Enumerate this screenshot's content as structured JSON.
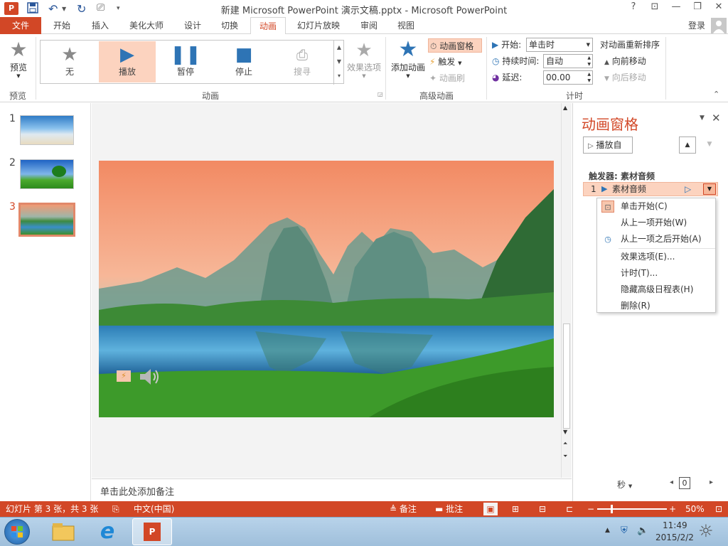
{
  "window": {
    "title": "新建 Microsoft PowerPoint 演示文稿.pptx - Microsoft PowerPoint",
    "help": "?",
    "controls": [
      "⊡",
      "—",
      "❐",
      "✕"
    ]
  },
  "tabs": {
    "file": "文件",
    "items": [
      "开始",
      "插入",
      "美化大师",
      "设计",
      "切换",
      "动画",
      "幻灯片放映",
      "审阅",
      "视图"
    ],
    "active": "动画",
    "login": "登录"
  },
  "ribbon": {
    "preview": {
      "label": "预览",
      "group": "预览"
    },
    "gallery": {
      "items": [
        "无",
        "播放",
        "暂停",
        "停止",
        "搜寻"
      ],
      "selected": "播放",
      "group": "动画"
    },
    "effect_options": "效果选项",
    "advanced": {
      "add": "添加动画",
      "pane": "动画窗格",
      "trigger": "触发",
      "painter": "动画刷",
      "group": "高级动画"
    },
    "timing": {
      "start_label": "开始:",
      "start_value": "单击时",
      "duration_label": "持续时间:",
      "duration_value": "自动",
      "delay_label": "延迟:",
      "delay_value": "00.00",
      "group": "计时"
    },
    "reorder": {
      "title": "对动画重新排序",
      "forward": "向前移动",
      "backward": "向后移动"
    }
  },
  "slides": {
    "numbers": [
      "1",
      "2",
      "3"
    ],
    "selected": 3
  },
  "notes_placeholder": "单击此处添加备注",
  "anim_pane": {
    "title": "动画窗格",
    "play_from": "播放自",
    "trigger_label": "触发器: 素材音频",
    "item_index": "1",
    "item_name": "素材音频",
    "menu": [
      {
        "label": "单击开始(C)",
        "icon": "mouse-click-icon"
      },
      {
        "label": "从上一项开始(W)",
        "icon": ""
      },
      {
        "label": "从上一项之后开始(A)",
        "icon": "clock-icon"
      },
      {
        "label": "效果选项(E)...",
        "icon": ""
      },
      {
        "label": "计时(T)...",
        "icon": ""
      },
      {
        "label": "隐藏高级日程表(H)",
        "icon": ""
      },
      {
        "label": "删除(R)",
        "icon": ""
      }
    ],
    "seconds": "秒",
    "zoom_value": "0"
  },
  "status": {
    "slide_info": "幻灯片 第 3 张，共 3 张",
    "language": "中文(中国)",
    "notes": "备注",
    "comments": "批注",
    "zoom": "50%"
  },
  "taskbar": {
    "time": "11:49",
    "date": "2015/2/2"
  },
  "colors": {
    "accent": "#d24726",
    "selection": "#fcd3bf",
    "star": "#2e74b5"
  }
}
